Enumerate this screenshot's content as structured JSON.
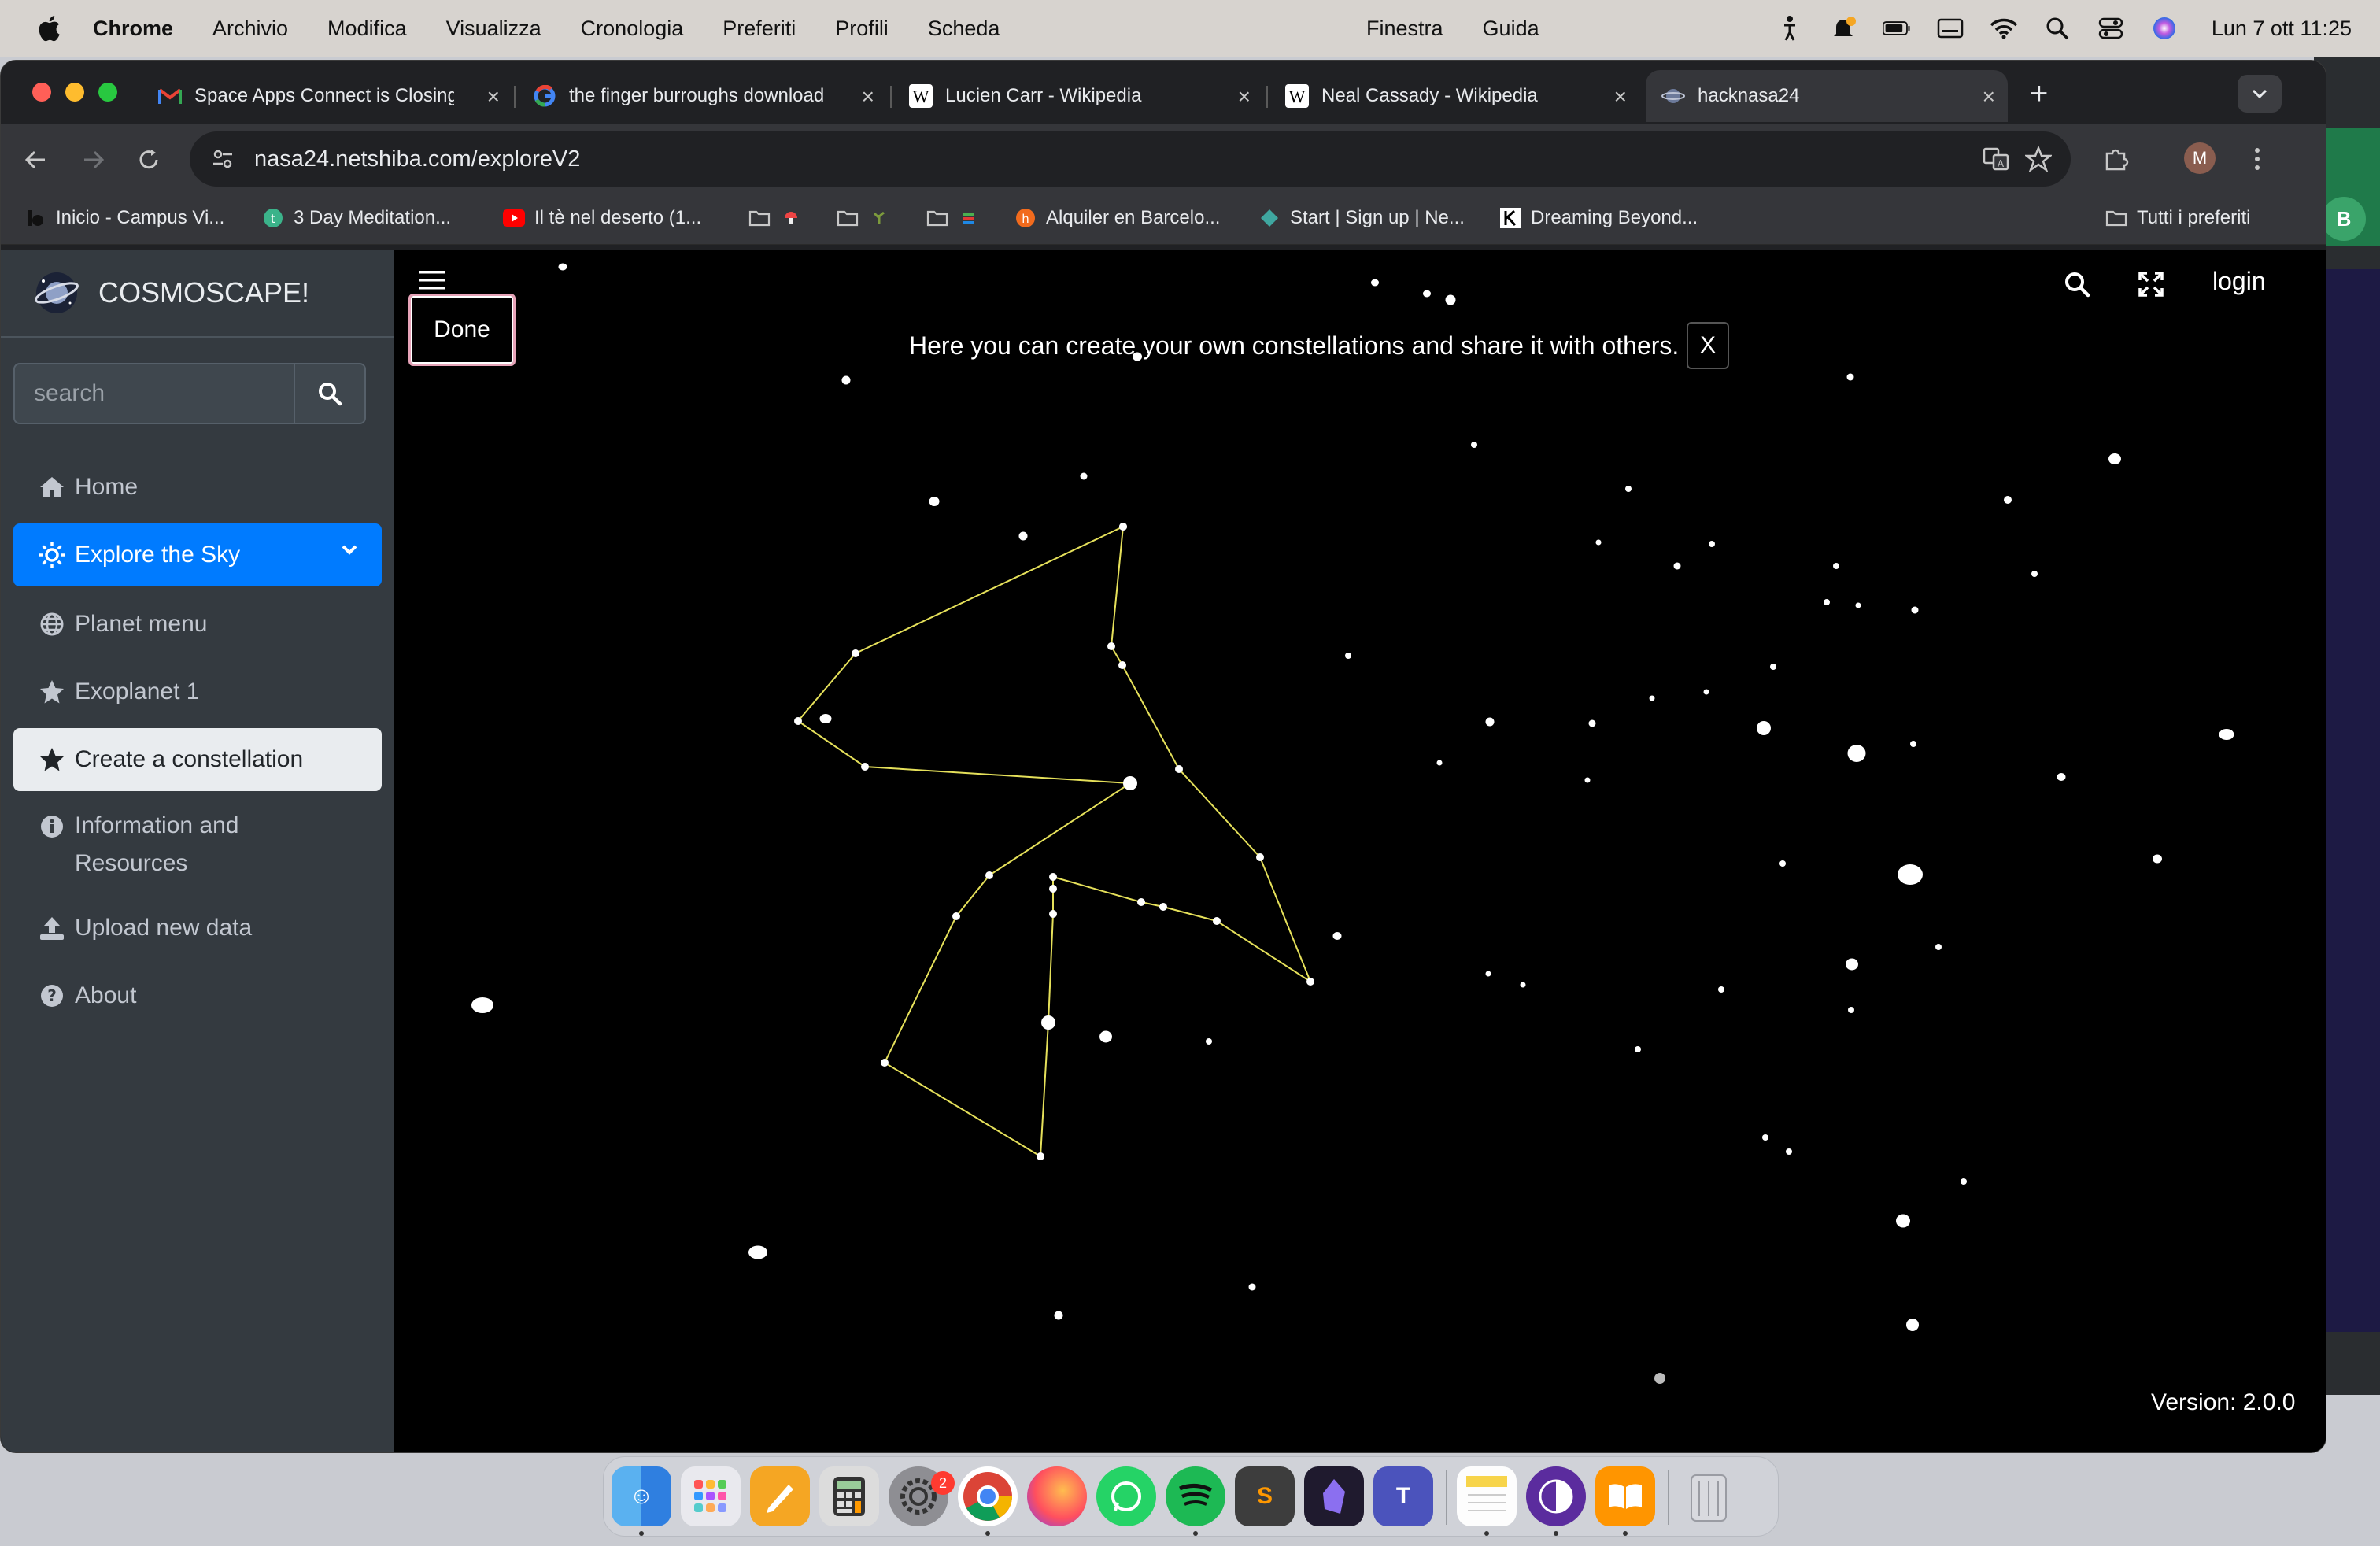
{
  "menubar": {
    "app_name": "Chrome",
    "menus": [
      "Archivio",
      "Modifica",
      "Visualizza",
      "Cronologia",
      "Preferiti",
      "Profili",
      "Scheda"
    ],
    "center_menus": [
      "Finestra",
      "Guida"
    ],
    "clock": "Lun 7 ott  11:25"
  },
  "browser": {
    "tabs": [
      {
        "title": "Space Apps Connect is Closing",
        "favicon": "gmail-icon"
      },
      {
        "title": "the finger burroughs download",
        "favicon": "google-icon"
      },
      {
        "title": "Lucien Carr - Wikipedia",
        "favicon": "wikipedia-icon"
      },
      {
        "title": "Neal Cassady - Wikipedia",
        "favicon": "wikipedia-icon"
      },
      {
        "title": "hacknasa24",
        "favicon": "site-icon",
        "active": true
      }
    ],
    "url": "nasa24.netshiba.com/exploreV2",
    "profile_initial": "M",
    "bookmarks": [
      {
        "label": "Inicio - Campus Vi..."
      },
      {
        "label": "3 Day Meditation..."
      },
      {
        "label": "Il tè nel deserto (1..."
      },
      {
        "label": ""
      },
      {
        "label": ""
      },
      {
        "label": ""
      },
      {
        "label": "Alquiler en Barcelo..."
      },
      {
        "label": "Start | Sign up | Ne..."
      },
      {
        "label": "Dreaming Beyond..."
      }
    ],
    "all_bookmarks": "Tutti i preferiti"
  },
  "sidebar": {
    "brand": "COSMOSCAPE!",
    "search_placeholder": "search",
    "items": [
      {
        "label": "Home",
        "icon": "home-icon"
      },
      {
        "label": "Explore the Sky",
        "icon": "sun-icon",
        "state": "expanded"
      },
      {
        "label": "Planet menu",
        "icon": "globe-icon"
      },
      {
        "label": "Exoplanet 1",
        "icon": "star-icon"
      },
      {
        "label": "Create a constellation",
        "icon": "star-icon",
        "state": "selected"
      },
      {
        "label": "Information and Resources",
        "icon": "info-icon"
      },
      {
        "label": "Upload new data",
        "icon": "upload-icon"
      },
      {
        "label": "About",
        "icon": "question-icon"
      }
    ]
  },
  "canvas": {
    "done_label": "Done",
    "hint_text": "Here you can create your own constellations and share it with others.",
    "hint_close": "X",
    "login_label": "login",
    "version": "Version: 2.0.0",
    "constellation_color": "#e5e05a"
  },
  "side_window": {
    "badge": "B"
  },
  "dock": {
    "apps": [
      "Finder",
      "Launchpad",
      "Pages",
      "Calculator",
      "System Settings",
      "Chrome",
      "Firefox",
      "WhatsApp",
      "Spotify",
      "Sublime Text",
      "Obsidian",
      "Teams",
      "Notes",
      "Tor Browser",
      "Books",
      "Trash"
    ],
    "settings_badge": "2"
  },
  "colors": {
    "accent": "#007bff",
    "sidebar_bg": "#343a40",
    "done_border": "#e6a3b8"
  }
}
